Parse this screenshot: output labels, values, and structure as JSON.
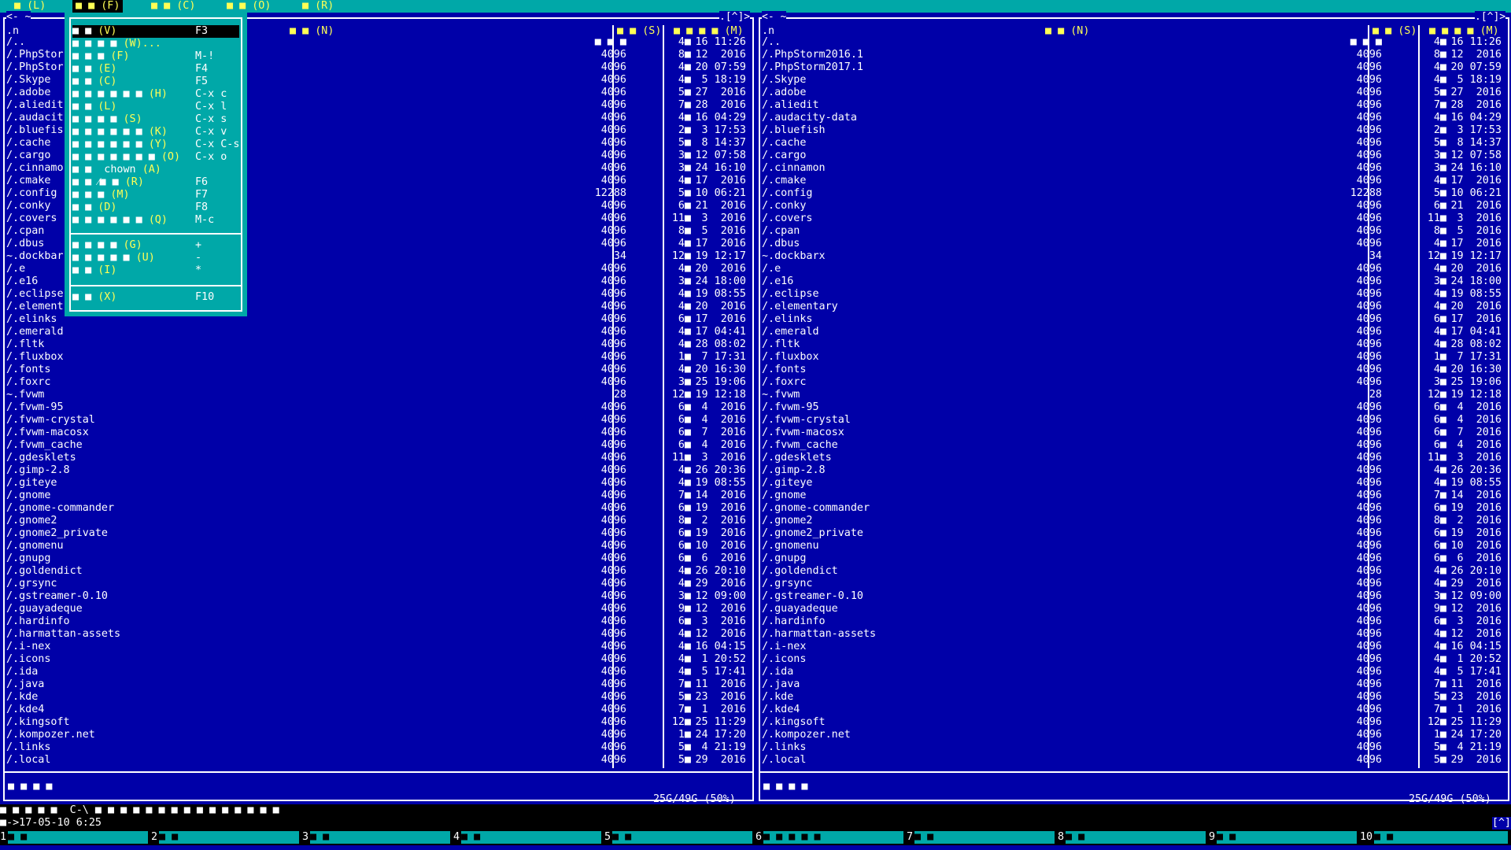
{
  "menubar": {
    "items": [
      {
        "label": "■ (L)",
        "active": false
      },
      {
        "label": "■ ■ (F)",
        "active": true
      },
      {
        "label": "■ ■ (C)",
        "active": false
      },
      {
        "label": "■ ■ (O)",
        "active": false
      },
      {
        "label": "■ (R)",
        "active": false
      }
    ]
  },
  "file_menu": {
    "items": [
      {
        "keys": "■ ■ ",
        "hot": "(V)",
        "shortcut": "F3",
        "selected": true
      },
      {
        "keys": "■ ■ ■ ■ ",
        "hot": "(W)...",
        "shortcut": "",
        "selected": false
      },
      {
        "keys": "■ ■ ■ ",
        "hot": "(F)",
        "shortcut": "M-!",
        "selected": false
      },
      {
        "keys": "■ ■ ",
        "hot": "(E)",
        "shortcut": "F4",
        "selected": false
      },
      {
        "keys": "■ ■ ",
        "hot": "(C)",
        "shortcut": "F5",
        "selected": false
      },
      {
        "keys": "■ ■ ■ ■ ■ ■ ",
        "hot": "(H)",
        "shortcut": "C-x c",
        "selected": false
      },
      {
        "keys": "■ ■ ",
        "hot": "(L)",
        "shortcut": "C-x l",
        "selected": false
      },
      {
        "keys": "■ ■ ■ ■ ",
        "hot": "(S)",
        "shortcut": "C-x s",
        "selected": false
      },
      {
        "keys": "■ ■ ■ ■ ■ ■ ",
        "hot": "(K)",
        "shortcut": "C-x v",
        "selected": false
      },
      {
        "keys": "■ ■ ■ ■ ■ ■ ",
        "hot": "(Y)",
        "shortcut": "C-x C-s",
        "selected": false
      },
      {
        "keys": "■ ■ ■ ■ ■ ■ ■ ",
        "hot": "(O)",
        "shortcut": "C-x o",
        "selected": false
      },
      {
        "keys": "■ ■  chown ",
        "hot": "(A)",
        "shortcut": "",
        "selected": false
      },
      {
        "keys": "■ ■ ⁄■ ■ ",
        "hot": "(R)",
        "shortcut": "F6",
        "selected": false
      },
      {
        "keys": "■ ■ ■ ",
        "hot": "(M)",
        "shortcut": "F7",
        "selected": false
      },
      {
        "keys": "■ ■ ",
        "hot": "(D)",
        "shortcut": "F8",
        "selected": false
      },
      {
        "keys": "■ ■ ■ ■ ■ ■ ",
        "hot": "(Q)",
        "shortcut": "M-c",
        "selected": false
      }
    ],
    "items2": [
      {
        "keys": "■ ■ ■ ■ ",
        "hot": "(G)",
        "shortcut": "+"
      },
      {
        "keys": "■ ■ ■ ■ ■ ",
        "hot": "(U)",
        "shortcut": "-"
      },
      {
        "keys": "■ ■ ",
        "hot": "(I)",
        "shortcut": "*"
      }
    ],
    "items3": [
      {
        "keys": "■ ■ ",
        "hot": "(X)",
        "shortcut": "F10"
      }
    ]
  },
  "left_panel": {
    "title_left": "<- ~",
    "title_right": ".[^]>",
    "col_name": ".n",
    "col_name_hdr": "■ ■ (N)",
    "col_size_hdr": "■ ■ (S)",
    "col_time_hdr": "■ ■ ■ ■ (M)",
    "mini_status": "■ ■ ■ ■",
    "space": "25G/49G (50%)"
  },
  "right_panel": {
    "title_left": "<- ~",
    "title_right": ".[^]>",
    "col_name": ".n",
    "col_name_hdr": "■ ■ (N)",
    "col_size_hdr": "■ ■ (S)",
    "col_time_hdr": "■ ■ ■ ■ (M)",
    "mini_status": "■ ■ ■ ■",
    "space": "25G/49G (50%)"
  },
  "files": [
    {
      "name": "/..",
      "size": "■ ■ ■",
      "mon": "4■",
      "time": "16 11:26"
    },
    {
      "name": "/.PhpStorm2016.1",
      "size": "4096",
      "mon": "8■",
      "time": "12  2016"
    },
    {
      "name": "/.PhpStorm2017.1",
      "size": "4096",
      "mon": "4■",
      "time": "20 07:59"
    },
    {
      "name": "/.Skype",
      "size": "4096",
      "mon": "4■",
      "time": " 5 18:19"
    },
    {
      "name": "/.adobe",
      "size": "4096",
      "mon": "5■",
      "time": "27  2016"
    },
    {
      "name": "/.aliedit",
      "size": "4096",
      "mon": "7■",
      "time": "28  2016"
    },
    {
      "name": "/.audacity-data",
      "size": "4096",
      "mon": "4■",
      "time": "16 04:29"
    },
    {
      "name": "/.bluefish",
      "size": "4096",
      "mon": "2■",
      "time": " 3 17:53"
    },
    {
      "name": "/.cache",
      "size": "4096",
      "mon": "5■",
      "time": " 8 14:37"
    },
    {
      "name": "/.cargo",
      "size": "4096",
      "mon": "3■",
      "time": "12 07:58"
    },
    {
      "name": "/.cinnamon",
      "size": "4096",
      "mon": "3■",
      "time": "24 16:10"
    },
    {
      "name": "/.cmake",
      "size": "4096",
      "mon": "4■",
      "time": "17  2016"
    },
    {
      "name": "/.config",
      "size": "12288",
      "mon": "5■",
      "time": "10 06:21"
    },
    {
      "name": "/.conky",
      "size": "4096",
      "mon": "6■",
      "time": "21  2016"
    },
    {
      "name": "/.covers",
      "size": "4096",
      "mon": "11■",
      "time": " 3  2016"
    },
    {
      "name": "/.cpan",
      "size": "4096",
      "mon": "8■",
      "time": " 5  2016"
    },
    {
      "name": "/.dbus",
      "size": "4096",
      "mon": "4■",
      "time": "17  2016"
    },
    {
      "name": "~.dockbarx",
      "size": "34",
      "mon": "12■",
      "time": "19 12:17"
    },
    {
      "name": "/.e",
      "size": "4096",
      "mon": "4■",
      "time": "20  2016"
    },
    {
      "name": "/.e16",
      "size": "4096",
      "mon": "3■",
      "time": "24 18:00"
    },
    {
      "name": "/.eclipse",
      "size": "4096",
      "mon": "4■",
      "time": "19 08:55"
    },
    {
      "name": "/.elementary",
      "size": "4096",
      "mon": "4■",
      "time": "20  2016"
    },
    {
      "name": "/.elinks",
      "size": "4096",
      "mon": "6■",
      "time": "17  2016"
    },
    {
      "name": "/.emerald",
      "size": "4096",
      "mon": "4■",
      "time": "17 04:41"
    },
    {
      "name": "/.fltk",
      "size": "4096",
      "mon": "4■",
      "time": "28 08:02"
    },
    {
      "name": "/.fluxbox",
      "size": "4096",
      "mon": "1■",
      "time": " 7 17:31"
    },
    {
      "name": "/.fonts",
      "size": "4096",
      "mon": "4■",
      "time": "20 16:30"
    },
    {
      "name": "/.foxrc",
      "size": "4096",
      "mon": "3■",
      "time": "25 19:06"
    },
    {
      "name": "~.fvwm",
      "size": "28",
      "mon": "12■",
      "time": "19 12:18"
    },
    {
      "name": "/.fvwm-95",
      "size": "4096",
      "mon": "6■",
      "time": " 4  2016"
    },
    {
      "name": "/.fvwm-crystal",
      "size": "4096",
      "mon": "6■",
      "time": " 4  2016"
    },
    {
      "name": "/.fvwm-macosx",
      "size": "4096",
      "mon": "6■",
      "time": " 7  2016"
    },
    {
      "name": "/.fvwm_cache",
      "size": "4096",
      "mon": "6■",
      "time": " 4  2016"
    },
    {
      "name": "/.gdesklets",
      "size": "4096",
      "mon": "11■",
      "time": " 3  2016"
    },
    {
      "name": "/.gimp-2.8",
      "size": "4096",
      "mon": "4■",
      "time": "26 20:36"
    },
    {
      "name": "/.giteye",
      "size": "4096",
      "mon": "4■",
      "time": "19 08:55"
    },
    {
      "name": "/.gnome",
      "size": "4096",
      "mon": "7■",
      "time": "14  2016"
    },
    {
      "name": "/.gnome-commander",
      "size": "4096",
      "mon": "6■",
      "time": "19  2016"
    },
    {
      "name": "/.gnome2",
      "size": "4096",
      "mon": "8■",
      "time": " 2  2016"
    },
    {
      "name": "/.gnome2_private",
      "size": "4096",
      "mon": "6■",
      "time": "19  2016"
    },
    {
      "name": "/.gnomenu",
      "size": "4096",
      "mon": "6■",
      "time": "10  2016"
    },
    {
      "name": "/.gnupg",
      "size": "4096",
      "mon": "6■",
      "time": " 6  2016"
    },
    {
      "name": "/.goldendict",
      "size": "4096",
      "mon": "4■",
      "time": "26 20:10"
    },
    {
      "name": "/.grsync",
      "size": "4096",
      "mon": "4■",
      "time": "29  2016"
    },
    {
      "name": "/.gstreamer-0.10",
      "size": "4096",
      "mon": "3■",
      "time": "12 09:00"
    },
    {
      "name": "/.guayadeque",
      "size": "4096",
      "mon": "9■",
      "time": "12  2016"
    },
    {
      "name": "/.hardinfo",
      "size": "4096",
      "mon": "6■",
      "time": " 3  2016"
    },
    {
      "name": "/.harmattan-assets",
      "size": "4096",
      "mon": "4■",
      "time": "12  2016"
    },
    {
      "name": "/.i-nex",
      "size": "4096",
      "mon": "4■",
      "time": "16 04:15"
    },
    {
      "name": "/.icons",
      "size": "4096",
      "mon": "4■",
      "time": " 1 20:52"
    },
    {
      "name": "/.ida",
      "size": "4096",
      "mon": "4■",
      "time": " 5 17:41"
    },
    {
      "name": "/.java",
      "size": "4096",
      "mon": "7■",
      "time": "11  2016"
    },
    {
      "name": "/.kde",
      "size": "4096",
      "mon": "5■",
      "time": "23  2016"
    },
    {
      "name": "/.kde4",
      "size": "4096",
      "mon": "7■",
      "time": " 1  2016"
    },
    {
      "name": "/.kingsoft",
      "size": "4096",
      "mon": "12■",
      "time": "25 11:29"
    },
    {
      "name": "/.kompozer.net",
      "size": "4096",
      "mon": "1■",
      "time": "24 17:20"
    },
    {
      "name": "/.links",
      "size": "4096",
      "mon": "5■",
      "time": " 4 21:19"
    },
    {
      "name": "/.local",
      "size": "4096",
      "mon": "5■",
      "time": "29  2016"
    }
  ],
  "left_visible_names": [
    "/..",
    "/.PhpStor",
    "/.PhpStor",
    "/.Skype",
    "/.adobe",
    "/.aliedit",
    "/.audacit",
    "/.bluefis",
    "/.cache",
    "/.cargo",
    "/.cinnamo",
    "/.cmake",
    "/.config",
    "/.conky",
    "/.covers",
    "/.cpan",
    "/.dbus",
    "~.dockbar",
    "/.e",
    "/.e16",
    "/.eclipse",
    "/.element"
  ],
  "cmdline": {
    "hint": "■ ■ ■ ■ ■  C-\\ ■ ■ ■ ■ ■ ■ ■ ■ ■ ■ ■ ■ ■ ■ ■",
    "prompt": "■->17-05-10 6:25",
    "corner": "[^]"
  },
  "fkeys": [
    {
      "num": "1",
      "label": "■ ■"
    },
    {
      "num": "2",
      "label": "■ ■"
    },
    {
      "num": "3",
      "label": "■ ■"
    },
    {
      "num": "4",
      "label": "■ ■"
    },
    {
      "num": "5",
      "label": "■ ■"
    },
    {
      "num": "6",
      "label": "■ ■ ■ ■ ■"
    },
    {
      "num": "7",
      "label": "■ ■"
    },
    {
      "num": "8",
      "label": "■ ■"
    },
    {
      "num": "9",
      "label": "■ ■"
    },
    {
      "num": "10",
      "label": "■ ■"
    }
  ],
  "colors": {
    "panel_bg": "#0000a8",
    "menu_bg": "#00a8a8",
    "hotkey": "#ffff55",
    "fg": "#ffffff"
  }
}
